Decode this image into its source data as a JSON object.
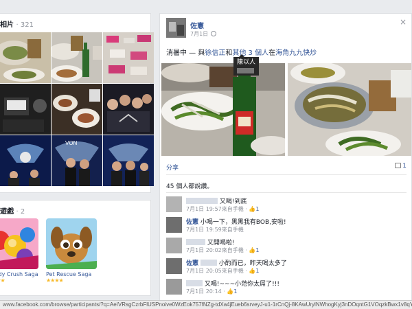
{
  "photos_section": {
    "title": "相片",
    "count": "· 321"
  },
  "games_section": {
    "title": "遊戲",
    "count": "· 2",
    "games": [
      {
        "name": "Candy Crush Saga",
        "stars": "★★★★"
      },
      {
        "name": "Pet Rescue Saga",
        "stars": "★★★★"
      }
    ]
  },
  "post": {
    "author": "佐憲",
    "date": "7月1日",
    "text_prefix": "消暑中 — 與",
    "text_names": "徐信正",
    "text_and": "和",
    "text_others": "其他 3 個人",
    "text_location_prefix": "在",
    "text_location": "海角九九快炒",
    "tooltip_line": "陳以人",
    "share_label": "分享",
    "comment_count": "1",
    "likes_text": "45 個人都說讚。",
    "close_label": "×"
  },
  "comments": [
    {
      "name": "",
      "text": "又喝!到底",
      "time": "7月1日 19:57來自手機",
      "likes": "1"
    },
    {
      "name": "佐憲",
      "text": "小喝一下，黑黑我有BOB,安啦!",
      "time": "7月1日 19:59來自手機",
      "likes": ""
    },
    {
      "name": "",
      "text": "又開喝啦!",
      "time": "7月1日 20:02來自手機",
      "likes": "1"
    },
    {
      "name": "佐憲",
      "text": "小酌而已，昨天喝太多了",
      "time": "7月1日 20:05來自手機",
      "likes": "1"
    },
    {
      "name": "",
      "text": "又喝!~~~小范你太屌了!!!",
      "time": "7月1日 20:14",
      "likes": "1"
    }
  ],
  "status_bar": {
    "url": "www.facebook.com/browse/participants/?q=AeIVRsgCzrbFlUSPnoive0WzEok757fNZg-tdXa4jEueb6srveyJ-u1-1rCnQj-8KAwUrylNWhogKyj3nDOqntG1VOqzkBwx1v8qYPth-_Z4tZmShD0"
  },
  "colors": {
    "link": "#365899",
    "background": "#e9ebee",
    "muted": "#90949c"
  }
}
